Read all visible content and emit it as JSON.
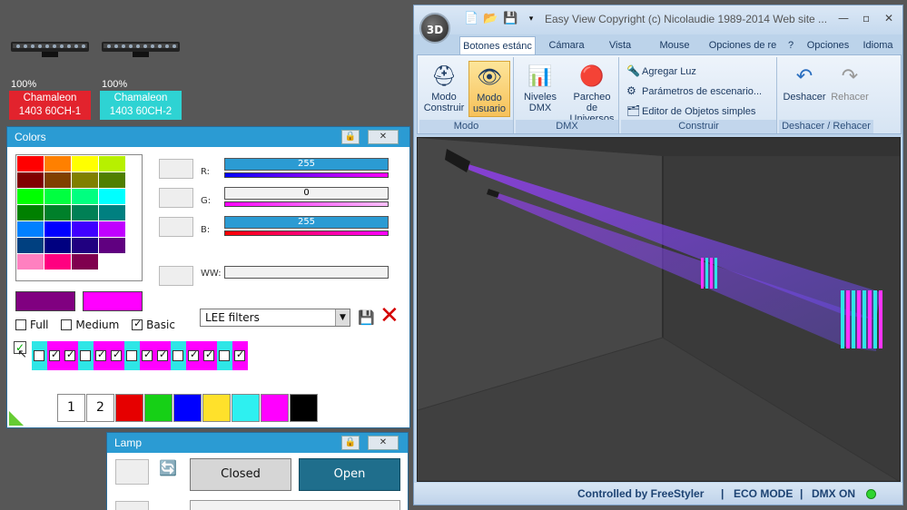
{
  "fixtures": [
    {
      "percent": "100%",
      "name": "Chamaleon",
      "model": "1403 60CH-1",
      "color": "#e2232d"
    },
    {
      "percent": "100%",
      "name": "Chamaleon",
      "model": "1403 60CH-2",
      "color": "#2ed3d3"
    }
  ],
  "colors_panel": {
    "title": "Colors",
    "grid_colors": [
      [
        "#ff0000",
        "#ff8000",
        "#ffff00",
        "#b7f000"
      ],
      [
        "#800000",
        "#804000",
        "#808000",
        "#4f7f00"
      ],
      [
        "#00ff00",
        "#00ff40",
        "#00ff80",
        "#00ffff"
      ],
      [
        "#008000",
        "#00802a",
        "#008055",
        "#008080"
      ],
      [
        "#0080ff",
        "#0000ff",
        "#4000ff",
        "#c000ff"
      ],
      [
        "#004080",
        "#000080",
        "#200080",
        "#600080"
      ],
      [
        "#ff80c0",
        "#ff0080",
        "#80004f",
        "#ffffff"
      ]
    ],
    "r_label": "R:",
    "g_label": "G:",
    "b_label": "B:",
    "ww_label": "WW:",
    "r_value": "255",
    "g_value": "0",
    "b_value": "255",
    "preview_left": "#800080",
    "preview_right": "#ff00ff",
    "checkboxes": [
      {
        "label": "Full",
        "checked": false
      },
      {
        "label": "Medium",
        "checked": false
      },
      {
        "label": "Basic",
        "checked": true
      }
    ],
    "filter_select": "LEE filters",
    "mini_strip": [
      {
        "color": "#2ee6e6",
        "checked": false
      },
      {
        "color": "#ff00ff",
        "checked": true
      },
      {
        "color": "#ff00ff",
        "checked": true
      },
      {
        "color": "#2ee6e6",
        "checked": false
      },
      {
        "color": "#ff00ff",
        "checked": true
      },
      {
        "color": "#ff00ff",
        "checked": true
      },
      {
        "color": "#2ee6e6",
        "checked": false
      },
      {
        "color": "#ff00ff",
        "checked": true
      },
      {
        "color": "#ff00ff",
        "checked": true
      },
      {
        "color": "#2ee6e6",
        "checked": false
      },
      {
        "color": "#ff00ff",
        "checked": true
      },
      {
        "color": "#ff00ff",
        "checked": true
      },
      {
        "color": "#2ee6e6",
        "checked": false
      },
      {
        "color": "#ff00ff",
        "checked": true
      }
    ],
    "swatches": [
      {
        "label": "1",
        "color": "#ffffff"
      },
      {
        "label": "2",
        "color": "#ffffff"
      },
      {
        "label": "",
        "color": "#e60000"
      },
      {
        "label": "",
        "color": "#16d016"
      },
      {
        "label": "",
        "color": "#0000ff"
      },
      {
        "label": "",
        "color": "#ffe12b"
      },
      {
        "label": "",
        "color": "#2ef0f0"
      },
      {
        "label": "",
        "color": "#ff00ff"
      },
      {
        "label": "",
        "color": "#000000"
      }
    ]
  },
  "lamp_panel": {
    "title": "Lamp",
    "closed_label": "Closed",
    "open_label": "Open"
  },
  "app": {
    "title": "Easy View   Copyright (c) Nicolaudie 1989-2014   Web site ...",
    "orb_label": "3D",
    "tabs": [
      "Botones estánc",
      "Cámara",
      "Vista",
      "Mouse",
      "Opciones de re"
    ],
    "right_tabs": [
      "?",
      "Opciones",
      "Idioma"
    ],
    "ribbon": {
      "modo": {
        "caption": "Modo",
        "construir": "Modo Construir",
        "usuario": "Modo usuario"
      },
      "dmx": {
        "caption": "DMX",
        "niveles": "Niveles DMX",
        "parcheo": "Parcheo de Universos"
      },
      "construir": {
        "caption": "Construir",
        "agregar": "Agregar Luz",
        "parametros": "Parámetros de escenario...",
        "editor": "Editor de Objetos simples"
      },
      "deshacer": {
        "caption": "Deshacer / Rehacer",
        "deshacer": "Deshacer",
        "rehacer": "Rehacer"
      }
    },
    "status": {
      "controlled": "Controlled by FreeStyler",
      "eco": "ECO MODE",
      "dmx": "DMX ON"
    }
  },
  "colors": {
    "accent": "#2b9bd3",
    "magenta": "#ff00ff",
    "cyan": "#2ed3d3",
    "red": "#e2232d",
    "blue_dark": "#1f6e8c"
  }
}
